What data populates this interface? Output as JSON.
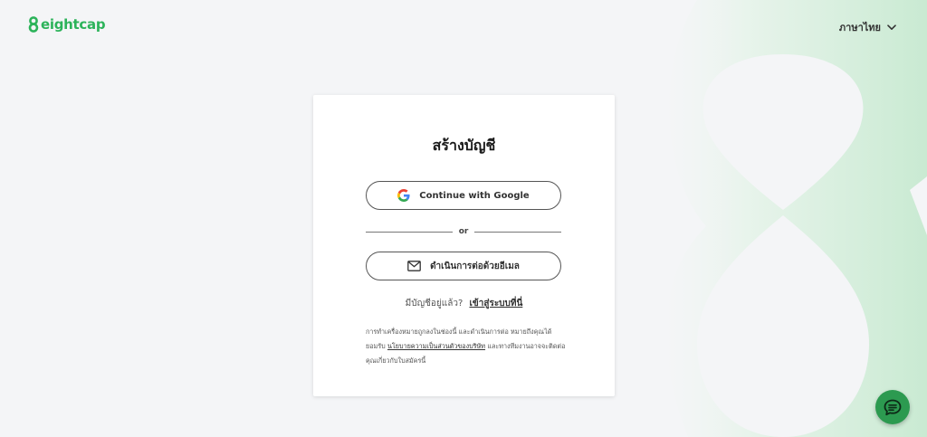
{
  "header": {
    "logo_text": "eightcap",
    "language_label": "ภาษาไทย"
  },
  "card": {
    "title": "สร้างบัญชี",
    "google_button_label": "Continue with Google",
    "divider_text": "or",
    "email_button_label": "ดำเนินการต่อด้วยอีเมล",
    "signin_prompt": "มีบัญชีอยู่แล้ว?",
    "signin_link": "เข้าสู่ระบบที่นี่",
    "terms_part1": "การทำเครื่องหมายถูกลงในช่องนี้ และดำเนินการต่อ หมายถึงคุณได้ยอมรับ",
    "terms_link": "นโยบายความเป็นส่วนตัวของบริษัท",
    "terms_part2": " และทางทีมงานอาจจะติดต่อคุณเกี่ยวกับใบสมัครนี้"
  },
  "colors": {
    "brand_green": "#2cb35a",
    "chat_green": "#2c9a50",
    "background": "#f4f5f7"
  },
  "icons": {
    "google": "google-g-icon",
    "email": "envelope-icon",
    "language_dropdown": "chevron-down-icon",
    "chat": "chat-bubble-icon"
  }
}
